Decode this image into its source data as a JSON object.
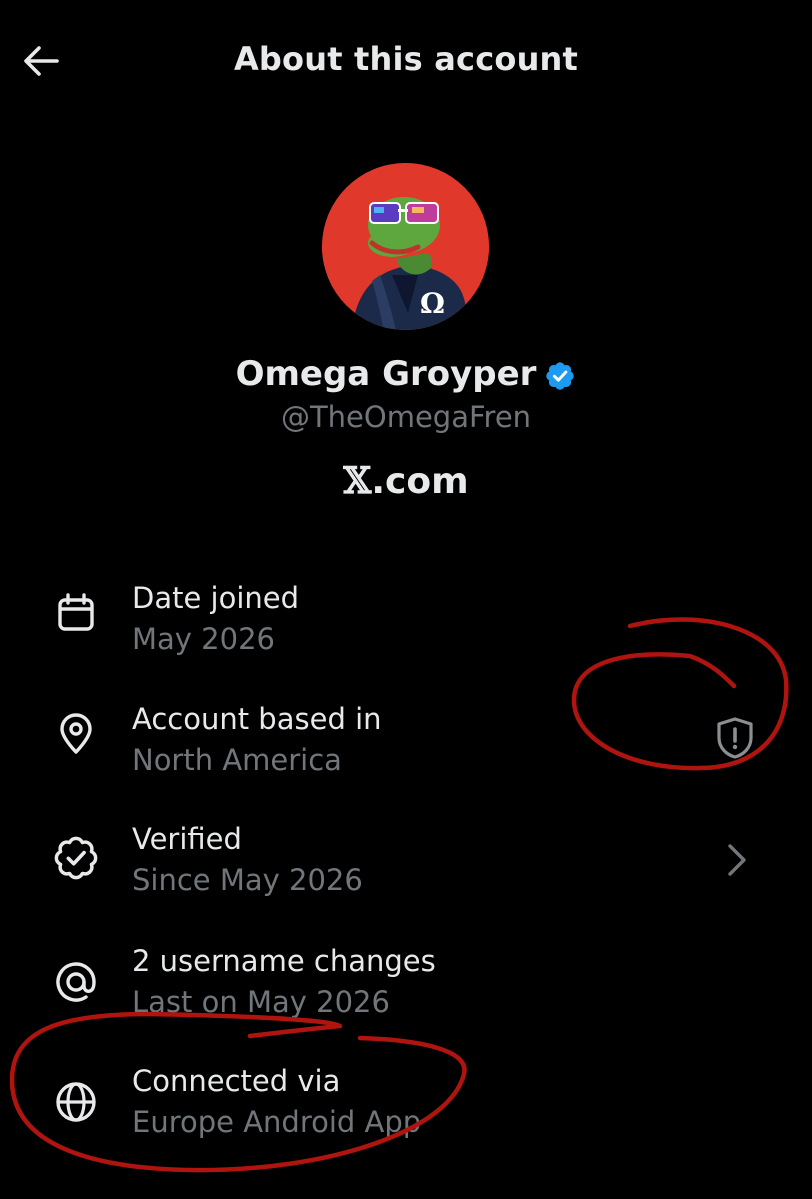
{
  "header": {
    "title": "About this account",
    "back_icon": "arrow-left-icon"
  },
  "profile": {
    "display_name": "Omega Groyper",
    "handle": "@TheOmegaFren",
    "verified": true,
    "brand_x": "𝕏",
    "brand_domain": ".com",
    "avatar_background": "#e0382b"
  },
  "rows": [
    {
      "icon": "calendar-icon",
      "label": "Date joined",
      "value": "May 2026"
    },
    {
      "icon": "location-pin-icon",
      "label": "Account based in",
      "value": "North America",
      "trailing_icon": "shield-alert-icon"
    },
    {
      "icon": "verified-badge-icon",
      "label": "Verified",
      "value": "Since May 2026",
      "trailing_icon": "chevron-right-icon"
    },
    {
      "icon": "at-sign-icon",
      "label": "2 username changes",
      "value": "Last on May 2026"
    },
    {
      "icon": "globe-icon",
      "label": "Connected via",
      "value": "Europe Android App"
    }
  ],
  "colors": {
    "background": "#000000",
    "primary_text": "#e7e9ea",
    "secondary_text": "#71767b",
    "verified_blue": "#1d9bf0",
    "annotation_red": "#b0140f"
  }
}
